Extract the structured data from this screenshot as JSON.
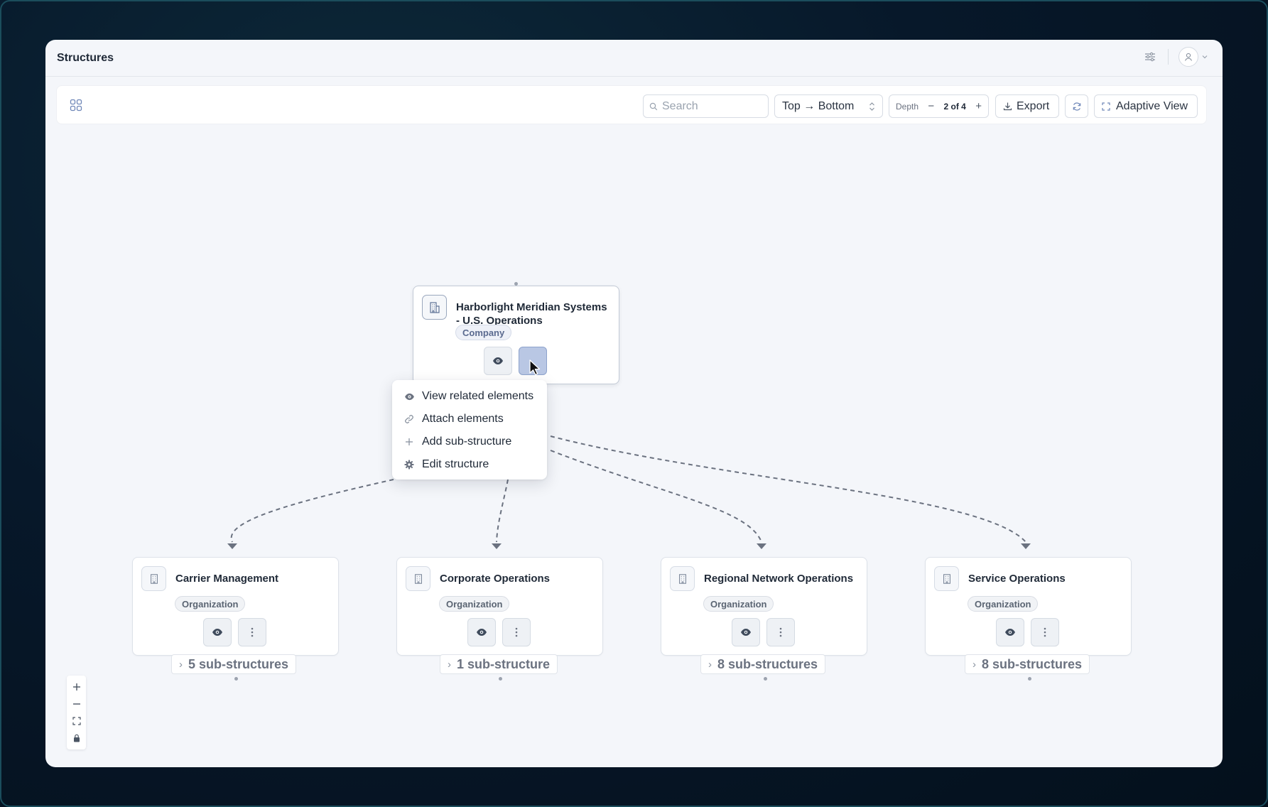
{
  "app": {
    "title": "Structures"
  },
  "toolbar": {
    "search_placeholder": "Search",
    "orientation": "Top → Bottom",
    "depth_label": "Depth",
    "depth_value": "2 of 4",
    "depth_minus": "−",
    "depth_plus": "+",
    "export_label": "Export",
    "adaptive_label": "Adaptive View"
  },
  "root": {
    "title_line1": "Harborlight Meridian Systems",
    "title_line2": "- U.S. Operations",
    "badge": "Company"
  },
  "menu": {
    "items": [
      {
        "label": "View related elements",
        "icon": "eye-icon"
      },
      {
        "label": "Attach elements",
        "icon": "link-icon"
      },
      {
        "label": "Add sub-structure",
        "icon": "plus-icon"
      },
      {
        "label": "Edit structure",
        "icon": "gear-icon"
      }
    ]
  },
  "children": [
    {
      "title": "Carrier Management",
      "badge": "Organization",
      "sub": "5 sub-structures"
    },
    {
      "title": "Corporate Operations",
      "badge": "Organization",
      "sub": "1 sub-structure"
    },
    {
      "title": "Regional Network Operations",
      "badge": "Organization",
      "sub": "8 sub-structures"
    },
    {
      "title": "Service Operations",
      "badge": "Organization",
      "sub": "8 sub-structures"
    }
  ],
  "zoom": {
    "in": "+",
    "out": "−"
  },
  "colors": {
    "accent": "#b9c7e4",
    "edge": "#6b7280",
    "text": "#1f2937"
  }
}
